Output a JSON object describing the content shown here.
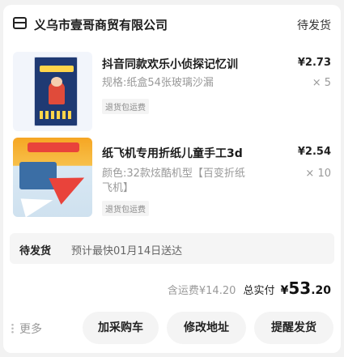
{
  "header": {
    "store_name": "义乌市壹哥商贸有限公司",
    "order_status": "待发货"
  },
  "items": [
    {
      "title": "抖音同款欢乐小侦探记忆训",
      "price": "¥2.73",
      "spec": "规格:纸盒54张玻璃沙漏",
      "qty": "× 5",
      "tag": "退货包运费"
    },
    {
      "title": "纸飞机专用折纸儿童手工3d",
      "price": "¥2.54",
      "spec_line1": "颜色:32款炫酷机型【百变折纸",
      "spec_line2": "飞机】",
      "qty": "× 10",
      "tag": "退货包运费"
    }
  ],
  "shipping": {
    "status": "待发货",
    "eta": "预计最快01月14日送达"
  },
  "totals": {
    "freight": "含运费¥14.20",
    "label": "总实付",
    "currency": "¥",
    "amount_int": "53",
    "amount_dec": ".20"
  },
  "actions": {
    "more": "更多",
    "add_cart": "加采购车",
    "edit_address": "修改地址",
    "remind_ship": "提醒发货"
  },
  "icons": {
    "store": "store-icon",
    "more": "more-dots-icon"
  },
  "colors": {
    "background": "#f2f2f2",
    "card": "#ffffff",
    "button": "#f4f4f4",
    "muted_text": "#999999"
  }
}
